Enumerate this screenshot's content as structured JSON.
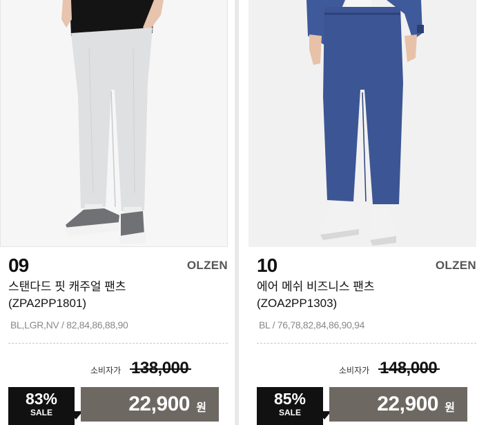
{
  "products": [
    {
      "number": "09",
      "brand": "OLZEN",
      "name": "스탠다드 핏 캐주얼 팬츠",
      "code": "(ZPA2PP1801)",
      "sizes": "BL,LGR,NV / 82,84,86,88,90",
      "original_label": "소비자가",
      "original_price": "138,000",
      "discount": "83%",
      "sale_label": "SALE",
      "price": "22,900",
      "currency": "원",
      "colors": {
        "pants": "#dfe0e2",
        "shirt": "#141414",
        "shoes": "#6f7175"
      }
    },
    {
      "number": "10",
      "brand": "OLZEN",
      "name": "에어 메쉬 비즈니스 팬츠",
      "code": "(ZOA2PP1303)",
      "sizes": "BL / 76,78,82,84,86,90,94",
      "original_label": "소비자가",
      "original_price": "148,000",
      "discount": "85%",
      "sale_label": "SALE",
      "price": "22,900",
      "currency": "원",
      "colors": {
        "pants": "#3c5594",
        "jacket": "#3f5a9b",
        "shoes": "#f2f2f2"
      }
    }
  ],
  "colors": {
    "sale_box": "#111111",
    "price_box": "#6e6863"
  }
}
